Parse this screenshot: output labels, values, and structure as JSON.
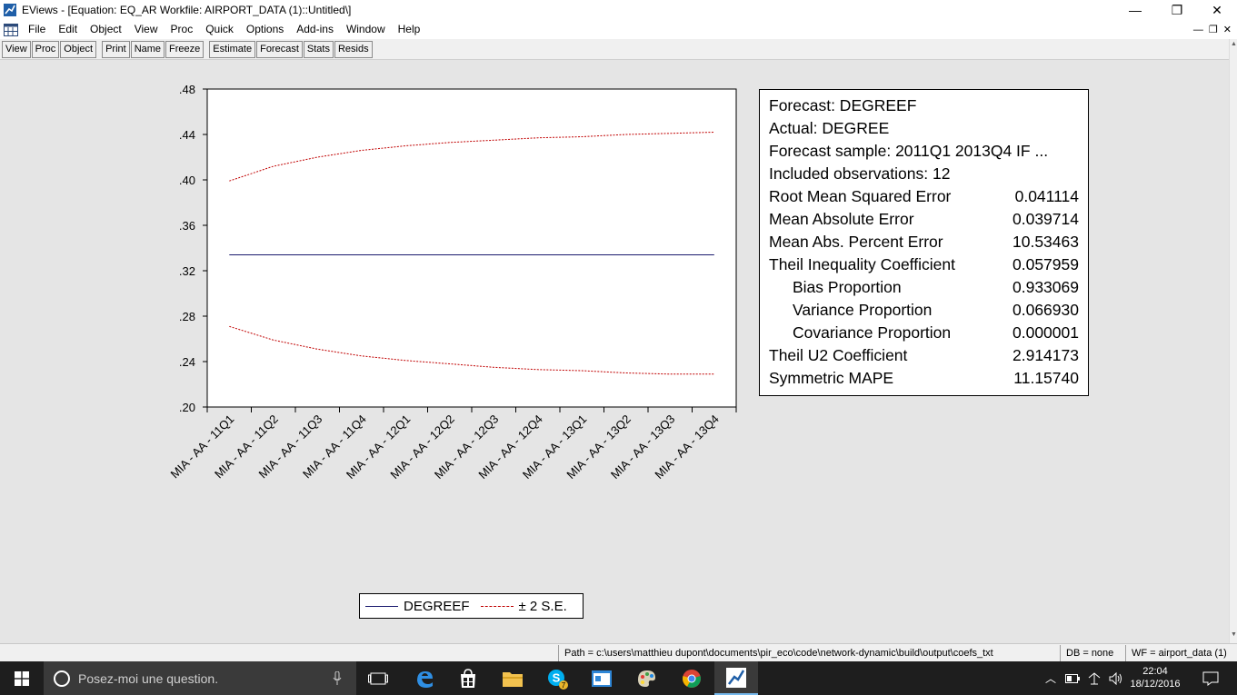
{
  "window": {
    "title": "EViews - [Equation: EQ_AR   Workfile: AIRPORT_DATA (1)::Untitled\\]",
    "minimize": "—",
    "maximize": "❐",
    "close": "✕"
  },
  "menu": {
    "items": [
      "File",
      "Edit",
      "Object",
      "View",
      "Proc",
      "Quick",
      "Options",
      "Add-ins",
      "Window",
      "Help"
    ],
    "mdi": [
      "—",
      "❐",
      "✕"
    ]
  },
  "toolbar": {
    "group1": [
      "View",
      "Proc",
      "Object"
    ],
    "group2": [
      "Print",
      "Name",
      "Freeze"
    ],
    "group3": [
      "Estimate",
      "Forecast",
      "Stats",
      "Resids"
    ]
  },
  "chart_data": {
    "type": "line",
    "title": "",
    "xlabel": "",
    "ylabel": "",
    "ylim": [
      0.2,
      0.48
    ],
    "yticks": [
      ".48",
      ".44",
      ".40",
      ".36",
      ".32",
      ".28",
      ".24",
      ".20"
    ],
    "ytick_values": [
      0.48,
      0.44,
      0.4,
      0.36,
      0.32,
      0.28,
      0.24,
      0.2
    ],
    "categories": [
      "MIA - AA - 11Q1",
      "MIA - AA - 11Q2",
      "MIA - AA - 11Q3",
      "MIA - AA - 11Q4",
      "MIA - AA - 12Q1",
      "MIA - AA - 12Q2",
      "MIA - AA - 12Q3",
      "MIA - AA - 12Q4",
      "MIA - AA - 13Q1",
      "MIA - AA - 13Q2",
      "MIA - AA - 13Q3",
      "MIA - AA - 13Q4"
    ],
    "series": [
      {
        "name": "DEGREEF",
        "color": "#1a1a6e",
        "style": "solid",
        "values": [
          0.334,
          0.334,
          0.334,
          0.334,
          0.334,
          0.334,
          0.334,
          0.334,
          0.334,
          0.334,
          0.334,
          0.334
        ]
      },
      {
        "name": "± 2 S.E.",
        "color": "#c00000",
        "style": "dashed",
        "values": [
          0.399,
          0.412,
          0.42,
          0.426,
          0.43,
          0.433,
          0.435,
          0.437,
          0.438,
          0.44,
          0.441,
          0.442
        ]
      },
      {
        "name": "",
        "color": "#c00000",
        "style": "dashed",
        "values": [
          0.271,
          0.259,
          0.251,
          0.245,
          0.241,
          0.238,
          0.235,
          0.233,
          0.232,
          0.23,
          0.229,
          0.229
        ]
      }
    ],
    "grid": false,
    "legend_position": "bottom"
  },
  "stats": {
    "rows": [
      {
        "label": "Forecast: DEGREEF",
        "value": "",
        "indent": false
      },
      {
        "label": "Actual: DEGREE",
        "value": "",
        "indent": false
      },
      {
        "label": "Forecast sample: 2011Q1 2013Q4 IF ...",
        "value": "",
        "indent": false
      },
      {
        "label": "Included observations: 12",
        "value": "",
        "indent": false
      },
      {
        "label": "Root Mean Squared Error",
        "value": "0.041114",
        "indent": false
      },
      {
        "label": "Mean Absolute Error",
        "value": "0.039714",
        "indent": false
      },
      {
        "label": "Mean Abs. Percent Error",
        "value": "10.53463",
        "indent": false
      },
      {
        "label": "Theil Inequality Coefficient",
        "value": "0.057959",
        "indent": false
      },
      {
        "label": "Bias Proportion",
        "value": "0.933069",
        "indent": true
      },
      {
        "label": "Variance Proportion",
        "value": "0.066930",
        "indent": true
      },
      {
        "label": "Covariance Proportion",
        "value": "0.000001",
        "indent": true
      },
      {
        "label": "Theil U2 Coefficient",
        "value": "2.914173",
        "indent": false
      },
      {
        "label": "Symmetric MAPE",
        "value": "11.15740",
        "indent": false
      }
    ]
  },
  "legend": {
    "entries": [
      "DEGREEF",
      "± 2 S.E."
    ]
  },
  "statusbar": {
    "path": "Path = c:\\users\\matthieu dupont\\documents\\pir_eco\\code\\network-dynamic\\build\\output\\coefs_txt",
    "db": "DB = none",
    "wf": "WF = airport_data (1)"
  },
  "taskbar": {
    "search_placeholder": "Posez-moi une question.",
    "time": "22:04",
    "date": "18/12/2016",
    "skype_badge": "7"
  },
  "colors": {
    "content_bg": "#e5e5e5",
    "forecast_line": "#1a1a6e",
    "se_band": "#c00000",
    "taskbar": "#1e1e1e"
  }
}
